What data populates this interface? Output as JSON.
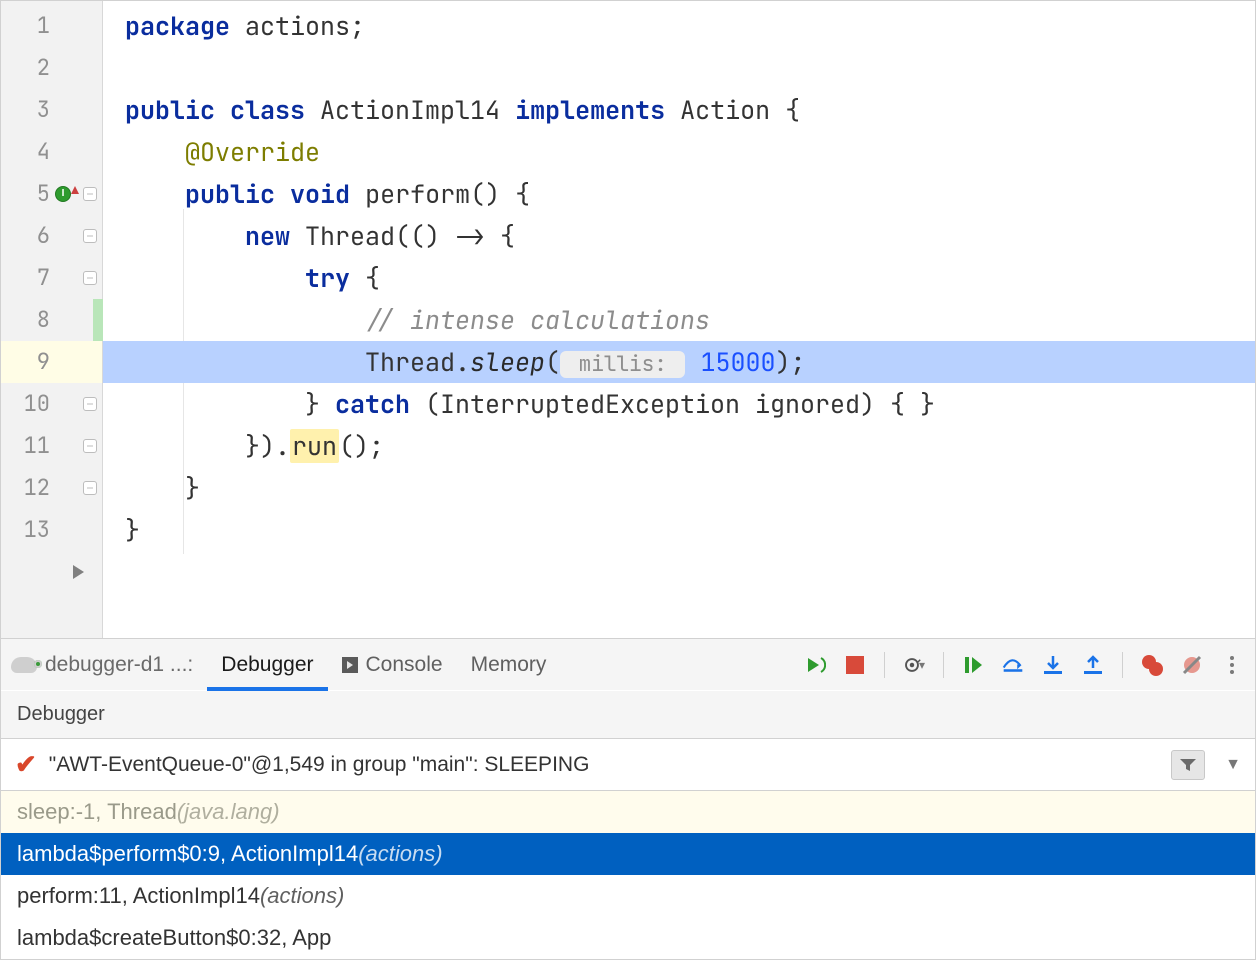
{
  "editor": {
    "lines": [
      {
        "n": "1"
      },
      {
        "n": "2"
      },
      {
        "n": "3"
      },
      {
        "n": "4"
      },
      {
        "n": "5"
      },
      {
        "n": "6"
      },
      {
        "n": "7"
      },
      {
        "n": "8"
      },
      {
        "n": "9"
      },
      {
        "n": "10"
      },
      {
        "n": "11"
      },
      {
        "n": "12"
      },
      {
        "n": "13"
      }
    ],
    "code": {
      "l1_kw1": "package",
      "l1_pkg": " actions;",
      "l3_kw1": "public",
      "l3_kw2": "class",
      "l3_name": " ActionImpl14 ",
      "l3_kw3": "implements",
      "l3_impl": " Action {",
      "l4_ann": "@Override",
      "l5_kw1": "public",
      "l5_kw2": "void",
      "l5_sig": " perform() {",
      "l6_kw": "new",
      "l6_rest": " Thread(() -> {",
      "l7_kw": "try",
      "l7_rest": " {",
      "l8_cm": "// intense calculations",
      "l9_pre": "Thread.",
      "l9_sleep": "sleep",
      "l9_open": "(",
      "l9_hint": " millis: ",
      "l9_num": "15000",
      "l9_close": ");",
      "l10_close": "} ",
      "l10_kw": "catch",
      "l10_rest": " (InterruptedException ignored) { }",
      "l11_pre": "}).",
      "l11_run": "run",
      "l11_post": "();",
      "l12": "}",
      "l13": "}"
    }
  },
  "panel": {
    "run_label": "debugger-d1 ...:",
    "tabs": {
      "debugger": "Debugger",
      "console": "Console",
      "memory": "Memory"
    },
    "sub_label": "Debugger",
    "thread_status": "\"AWT-EventQueue-0\"@1,549 in group \"main\": SLEEPING",
    "frames": [
      {
        "main": "sleep:-1, Thread ",
        "pkg": "(java.lang)",
        "kind": "dim"
      },
      {
        "main": "lambda$perform$0:9, ActionImpl14 ",
        "pkg": "(actions)",
        "kind": "sel"
      },
      {
        "main": "perform:11, ActionImpl14 ",
        "pkg": "(actions)",
        "kind": "norm"
      },
      {
        "main": "lambda$createButton$0:32, App",
        "pkg": "",
        "kind": "norm"
      }
    ]
  }
}
